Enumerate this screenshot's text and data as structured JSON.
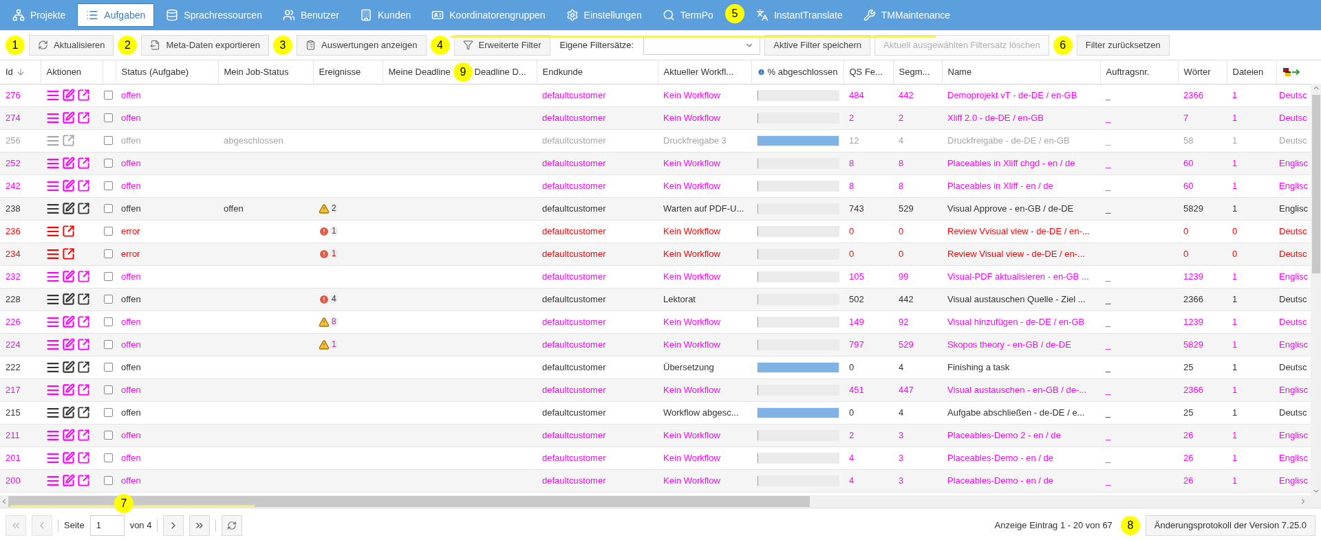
{
  "nav": [
    {
      "label": "Projekte",
      "selected": false
    },
    {
      "label": "Aufgaben",
      "selected": true
    },
    {
      "label": "Sprachressourcen",
      "selected": false
    },
    {
      "label": "Benutzer",
      "selected": false
    },
    {
      "label": "Kunden",
      "selected": false
    },
    {
      "label": "Koordinatorengruppen",
      "selected": false
    },
    {
      "label": "Einstellungen",
      "selected": false
    },
    {
      "label": "TermPo",
      "selected": false
    },
    {
      "label": "InstantTranslate",
      "selected": false
    },
    {
      "label": "TMMaintenance",
      "selected": false
    }
  ],
  "toolbar": {
    "buttons": [
      {
        "label": "Aktualisieren",
        "disabled": false
      },
      {
        "label": "Meta-Daten exportieren",
        "disabled": false
      },
      {
        "label": "Auswertungen anzeigen",
        "disabled": false
      },
      {
        "label": "Erweiterte Filter",
        "disabled": false
      }
    ],
    "filter_sets_label": "Eigene Filtersätze:",
    "filter_buttons": [
      {
        "label": "Aktive Filter speichern",
        "disabled": false
      },
      {
        "label": "Aktuell ausgewählten Filtersatz löschen",
        "disabled": true
      },
      {
        "label": "Filter zurücksetzen",
        "disabled": false
      }
    ]
  },
  "table": {
    "columns": [
      "Id",
      "Aktionen",
      "",
      "Status (Aufgabe)",
      "Mein Job-Status",
      "Ereignisse",
      "Meine Deadline",
      "Deadline D...",
      "Endkunde",
      "Aktueller Workfl...",
      "% abgeschlossen",
      "QS Fe...",
      "Segm...",
      "Name",
      "Auftragsnr.",
      "Wörter",
      "Dateien"
    ],
    "rows": [
      {
        "id": "276",
        "color": "#ff00ff",
        "editable": true,
        "checked": false,
        "status": "offen",
        "job_status": "",
        "event": null,
        "customer": "defaultcustomer",
        "workflow": "Kein Workflow",
        "level": 0,
        "qs": "484",
        "segments": "442",
        "name": "Demoprojekt vT - de-DE / en-GB",
        "order_no": "_",
        "words": "2366",
        "files": "1",
        "language": "Deutsc"
      },
      {
        "id": "274",
        "color": "#ff00ff",
        "editable": true,
        "checked": false,
        "status": "offen",
        "job_status": "",
        "event": null,
        "customer": "defaultcustomer",
        "workflow": "Kein Workflow",
        "level": 0,
        "qs": "2",
        "segments": "2",
        "name": "Xliff 2.0 - de-DE / en-GB",
        "order_no": "_",
        "words": "7",
        "files": "1",
        "language": "Deutsc"
      },
      {
        "id": "256",
        "color": "#a6a6a6",
        "editable": false,
        "checked": false,
        "status": "offen",
        "job_status": "abgeschlossen",
        "event": null,
        "customer": "defaultcustomer",
        "workflow": "Druckfreigabe 3",
        "level": 1,
        "qs": "12",
        "segments": "4",
        "name": "Druckfreigabe - de-DE / en-GB",
        "order_no": "_",
        "words": "58",
        "files": "1",
        "language": "Deutsc"
      },
      {
        "id": "252",
        "color": "#ff00ff",
        "editable": true,
        "checked": false,
        "status": "offen",
        "job_status": "",
        "event": null,
        "customer": "defaultcustomer",
        "workflow": "Kein Workflow",
        "level": 0,
        "qs": "8",
        "segments": "8",
        "name": "Placeables in Xliff chgd - en / de",
        "order_no": "_",
        "words": "60",
        "files": "1",
        "language": "Englisc"
      },
      {
        "id": "242",
        "color": "#ff00ff",
        "editable": true,
        "checked": false,
        "status": "offen",
        "job_status": "",
        "event": null,
        "customer": "defaultcustomer",
        "workflow": "Kein Workflow",
        "level": 0,
        "qs": "8",
        "segments": "8",
        "name": "Placeables in Xliff - en / de",
        "order_no": "_",
        "words": "60",
        "files": "1",
        "language": "Englisc"
      },
      {
        "id": "238",
        "color": "#333333",
        "editable": true,
        "checked": false,
        "status": "offen",
        "job_status": "offen",
        "event": {
          "kind": "warning",
          "count": "2"
        },
        "customer": "defaultcustomer",
        "workflow": "Warten auf PDF-U...",
        "level": 0,
        "qs": "743",
        "segments": "529",
        "name": "Visual Approve - en-GB / de-DE",
        "order_no": "_",
        "words": "5829",
        "files": "1",
        "language": "Englisc"
      },
      {
        "id": "236",
        "color": "#ff0000",
        "editable": false,
        "checked": false,
        "status": "error",
        "job_status": "",
        "event": {
          "kind": "error",
          "count": "1"
        },
        "customer": "defaultcustomer",
        "workflow": "Kein Workflow",
        "level": 0,
        "qs": "0",
        "segments": "0",
        "name": "Review Vvisual view - de-DE / en-...",
        "order_no": "",
        "words": "0",
        "files": "0",
        "language": "Deutsc"
      },
      {
        "id": "234",
        "color": "#ff0000",
        "editable": false,
        "checked": false,
        "status": "error",
        "job_status": "",
        "event": {
          "kind": "error",
          "count": "1"
        },
        "customer": "defaultcustomer",
        "workflow": "Kein Workflow",
        "level": 0,
        "qs": "0",
        "segments": "0",
        "name": "Review Visual view - de-DE / en-...",
        "order_no": "",
        "words": "0",
        "files": "0",
        "language": "Deutsc"
      },
      {
        "id": "232",
        "color": "#ff00ff",
        "editable": true,
        "checked": false,
        "status": "offen",
        "job_status": "",
        "event": null,
        "customer": "defaultcustomer",
        "workflow": "Kein Workflow",
        "level": 0,
        "qs": "105",
        "segments": "99",
        "name": "Visual-PDF aktualisieren - en-GB ...",
        "order_no": "_",
        "words": "1239",
        "files": "1",
        "language": "Englisc"
      },
      {
        "id": "228",
        "color": "#333333",
        "editable": true,
        "checked": false,
        "status": "offen",
        "job_status": "",
        "event": {
          "kind": "error",
          "count": "4"
        },
        "customer": "defaultcustomer",
        "workflow": "Lektorat",
        "level": 0,
        "qs": "502",
        "segments": "442",
        "name": "Visual austauschen Quelle - Ziel ...",
        "order_no": "_",
        "words": "2366",
        "files": "1",
        "language": "Deutsc"
      },
      {
        "id": "226",
        "color": "#ff00ff",
        "editable": true,
        "checked": false,
        "status": "offen",
        "job_status": "",
        "event": {
          "kind": "warning",
          "count": "8"
        },
        "customer": "defaultcustomer",
        "workflow": "Kein Workflow",
        "level": 0,
        "qs": "149",
        "segments": "92",
        "name": "Visual hinzufügen - de-DE / en-GB",
        "order_no": "_",
        "words": "1239",
        "files": "1",
        "language": "Deutsc"
      },
      {
        "id": "224",
        "color": "#ff00ff",
        "editable": true,
        "checked": false,
        "status": "offen",
        "job_status": "",
        "event": {
          "kind": "warning",
          "count": "1"
        },
        "customer": "defaultcustomer",
        "workflow": "Kein Workflow",
        "level": 0,
        "qs": "797",
        "segments": "529",
        "name": "Skopos theory - en-GB / de-DE",
        "order_no": "_",
        "words": "5829",
        "files": "1",
        "language": "Englisc"
      },
      {
        "id": "222",
        "color": "#333333",
        "editable": true,
        "checked": false,
        "status": "offen",
        "job_status": "",
        "event": null,
        "customer": "defaultcustomer",
        "workflow": "Übersetzung",
        "level": 1,
        "qs": "0",
        "segments": "4",
        "name": "Finishing a task",
        "order_no": "_",
        "words": "25",
        "files": "1",
        "language": "Deutsc"
      },
      {
        "id": "217",
        "color": "#ff00ff",
        "editable": true,
        "checked": false,
        "status": "offen",
        "job_status": "",
        "event": null,
        "customer": "defaultcustomer",
        "workflow": "Kein Workflow",
        "level": 0,
        "qs": "451",
        "segments": "447",
        "name": "Visual austauschen - en-GB / de-...",
        "order_no": "_",
        "words": "2366",
        "files": "1",
        "language": "Englisc"
      },
      {
        "id": "215",
        "color": "#333333",
        "editable": true,
        "checked": false,
        "status": "offen",
        "job_status": "",
        "event": null,
        "customer": "defaultcustomer",
        "workflow": "Workflow abgesc...",
        "level": 1,
        "qs": "0",
        "segments": "4",
        "name": "Aufgabe abschließen - de-DE / e...",
        "order_no": "_",
        "words": "25",
        "files": "1",
        "language": "Deutsc"
      },
      {
        "id": "211",
        "color": "#ff00ff",
        "editable": true,
        "checked": false,
        "status": "offen",
        "job_status": "",
        "event": null,
        "customer": "defaultcustomer",
        "workflow": "Kein Workflow",
        "level": 0,
        "qs": "2",
        "segments": "3",
        "name": "Placeables-Demo 2 - en / de",
        "order_no": "_",
        "words": "26",
        "files": "1",
        "language": "Englisc"
      },
      {
        "id": "201",
        "color": "#ff00ff",
        "editable": true,
        "checked": false,
        "status": "offen",
        "job_status": "",
        "event": null,
        "customer": "defaultcustomer",
        "workflow": "Kein Workflow",
        "level": 0,
        "qs": "4",
        "segments": "3",
        "name": "Placeables-Demo - en / de",
        "order_no": "_",
        "words": "26",
        "files": "1",
        "language": "Englisc"
      },
      {
        "id": "200",
        "color": "#ff00ff",
        "editable": true,
        "checked": false,
        "status": "offen",
        "job_status": "",
        "event": null,
        "customer": "defaultcustomer",
        "workflow": "Kein Workflow",
        "level": 0,
        "qs": "4",
        "segments": "3",
        "name": "Placeables-Demo - en / de",
        "order_no": "_",
        "words": "26",
        "files": "1",
        "language": "Englisc"
      }
    ]
  },
  "pager": {
    "page_label": "Seite",
    "page": "1",
    "of_label": "von 4",
    "summary": "Anzeige Eintrag 1 - 20 von 67",
    "changelog": "Änderungsprotokoll der Version 7.25.0"
  },
  "callouts": [
    "1",
    "2",
    "3",
    "4",
    "5",
    "6",
    "7",
    "8",
    "9"
  ]
}
